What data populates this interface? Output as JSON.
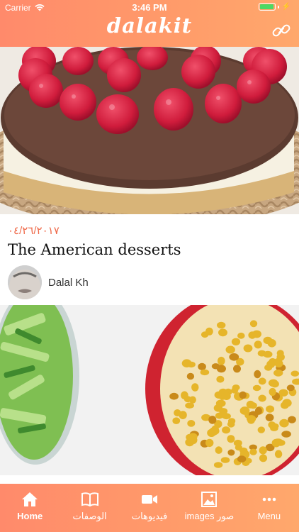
{
  "status": {
    "carrier": "Carrier",
    "time": "3:46 PM",
    "battery_level": 0.95
  },
  "header": {
    "brand": "dalakit",
    "link_icon": "link-icon"
  },
  "feed": {
    "cards": [
      {
        "date": "٠٤/٢٦/٢٠١٧",
        "title": "The American desserts",
        "author": "Dalal Kh"
      }
    ]
  },
  "tabs": [
    {
      "label": "Home",
      "icon": "home-icon",
      "active": true
    },
    {
      "label": "الوصفات",
      "icon": "book-icon",
      "active": false
    },
    {
      "label": "فيديوهات",
      "icon": "video-icon",
      "active": false
    },
    {
      "label": "images صور",
      "icon": "image-icon",
      "active": false
    },
    {
      "label": "Menu",
      "icon": "more-icon",
      "active": false
    }
  ],
  "colors": {
    "accent": "#ff9a6a",
    "date": "#ef6a4a"
  }
}
